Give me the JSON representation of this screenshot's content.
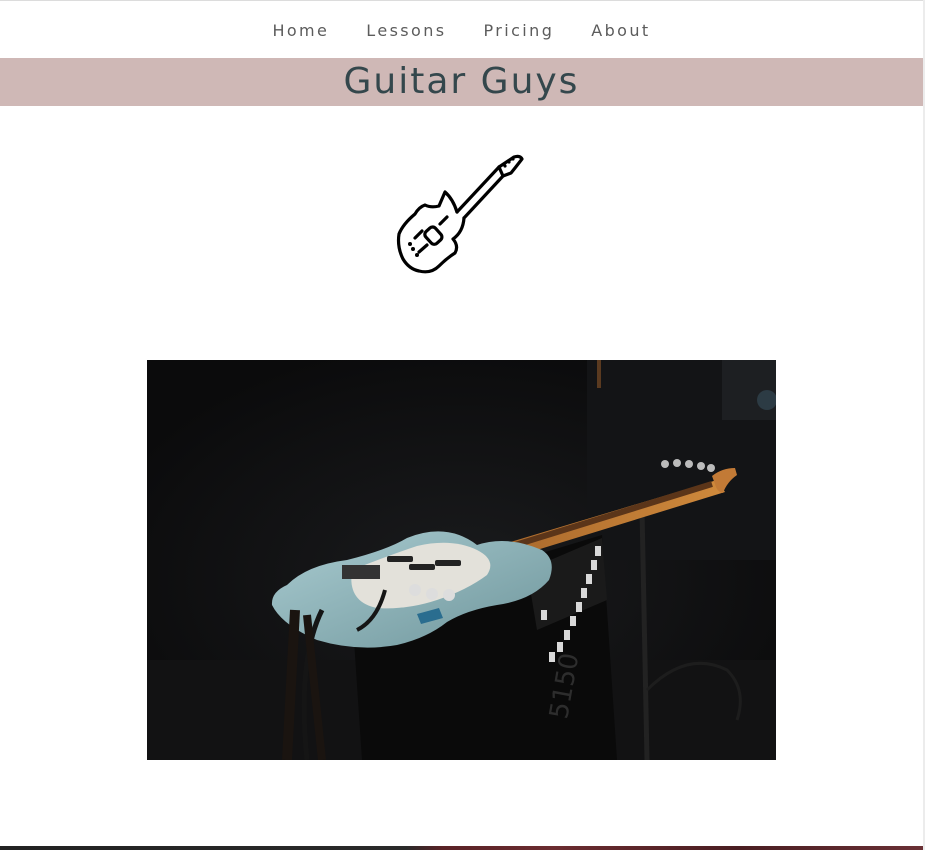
{
  "nav": {
    "items": [
      {
        "label": "Home"
      },
      {
        "label": "Lessons"
      },
      {
        "label": "Pricing"
      },
      {
        "label": "About"
      }
    ]
  },
  "header": {
    "title": "Guitar Guys"
  },
  "logo": {
    "icon": "electric-guitar-icon"
  },
  "hero_image": {
    "subject": "guitar-photo",
    "amp_text": "5150"
  },
  "colors": {
    "banner": "#cfb8b6",
    "title": "#34474c",
    "nav_text": "#5c5c5c",
    "guitar_body": "#8fb5bc"
  }
}
